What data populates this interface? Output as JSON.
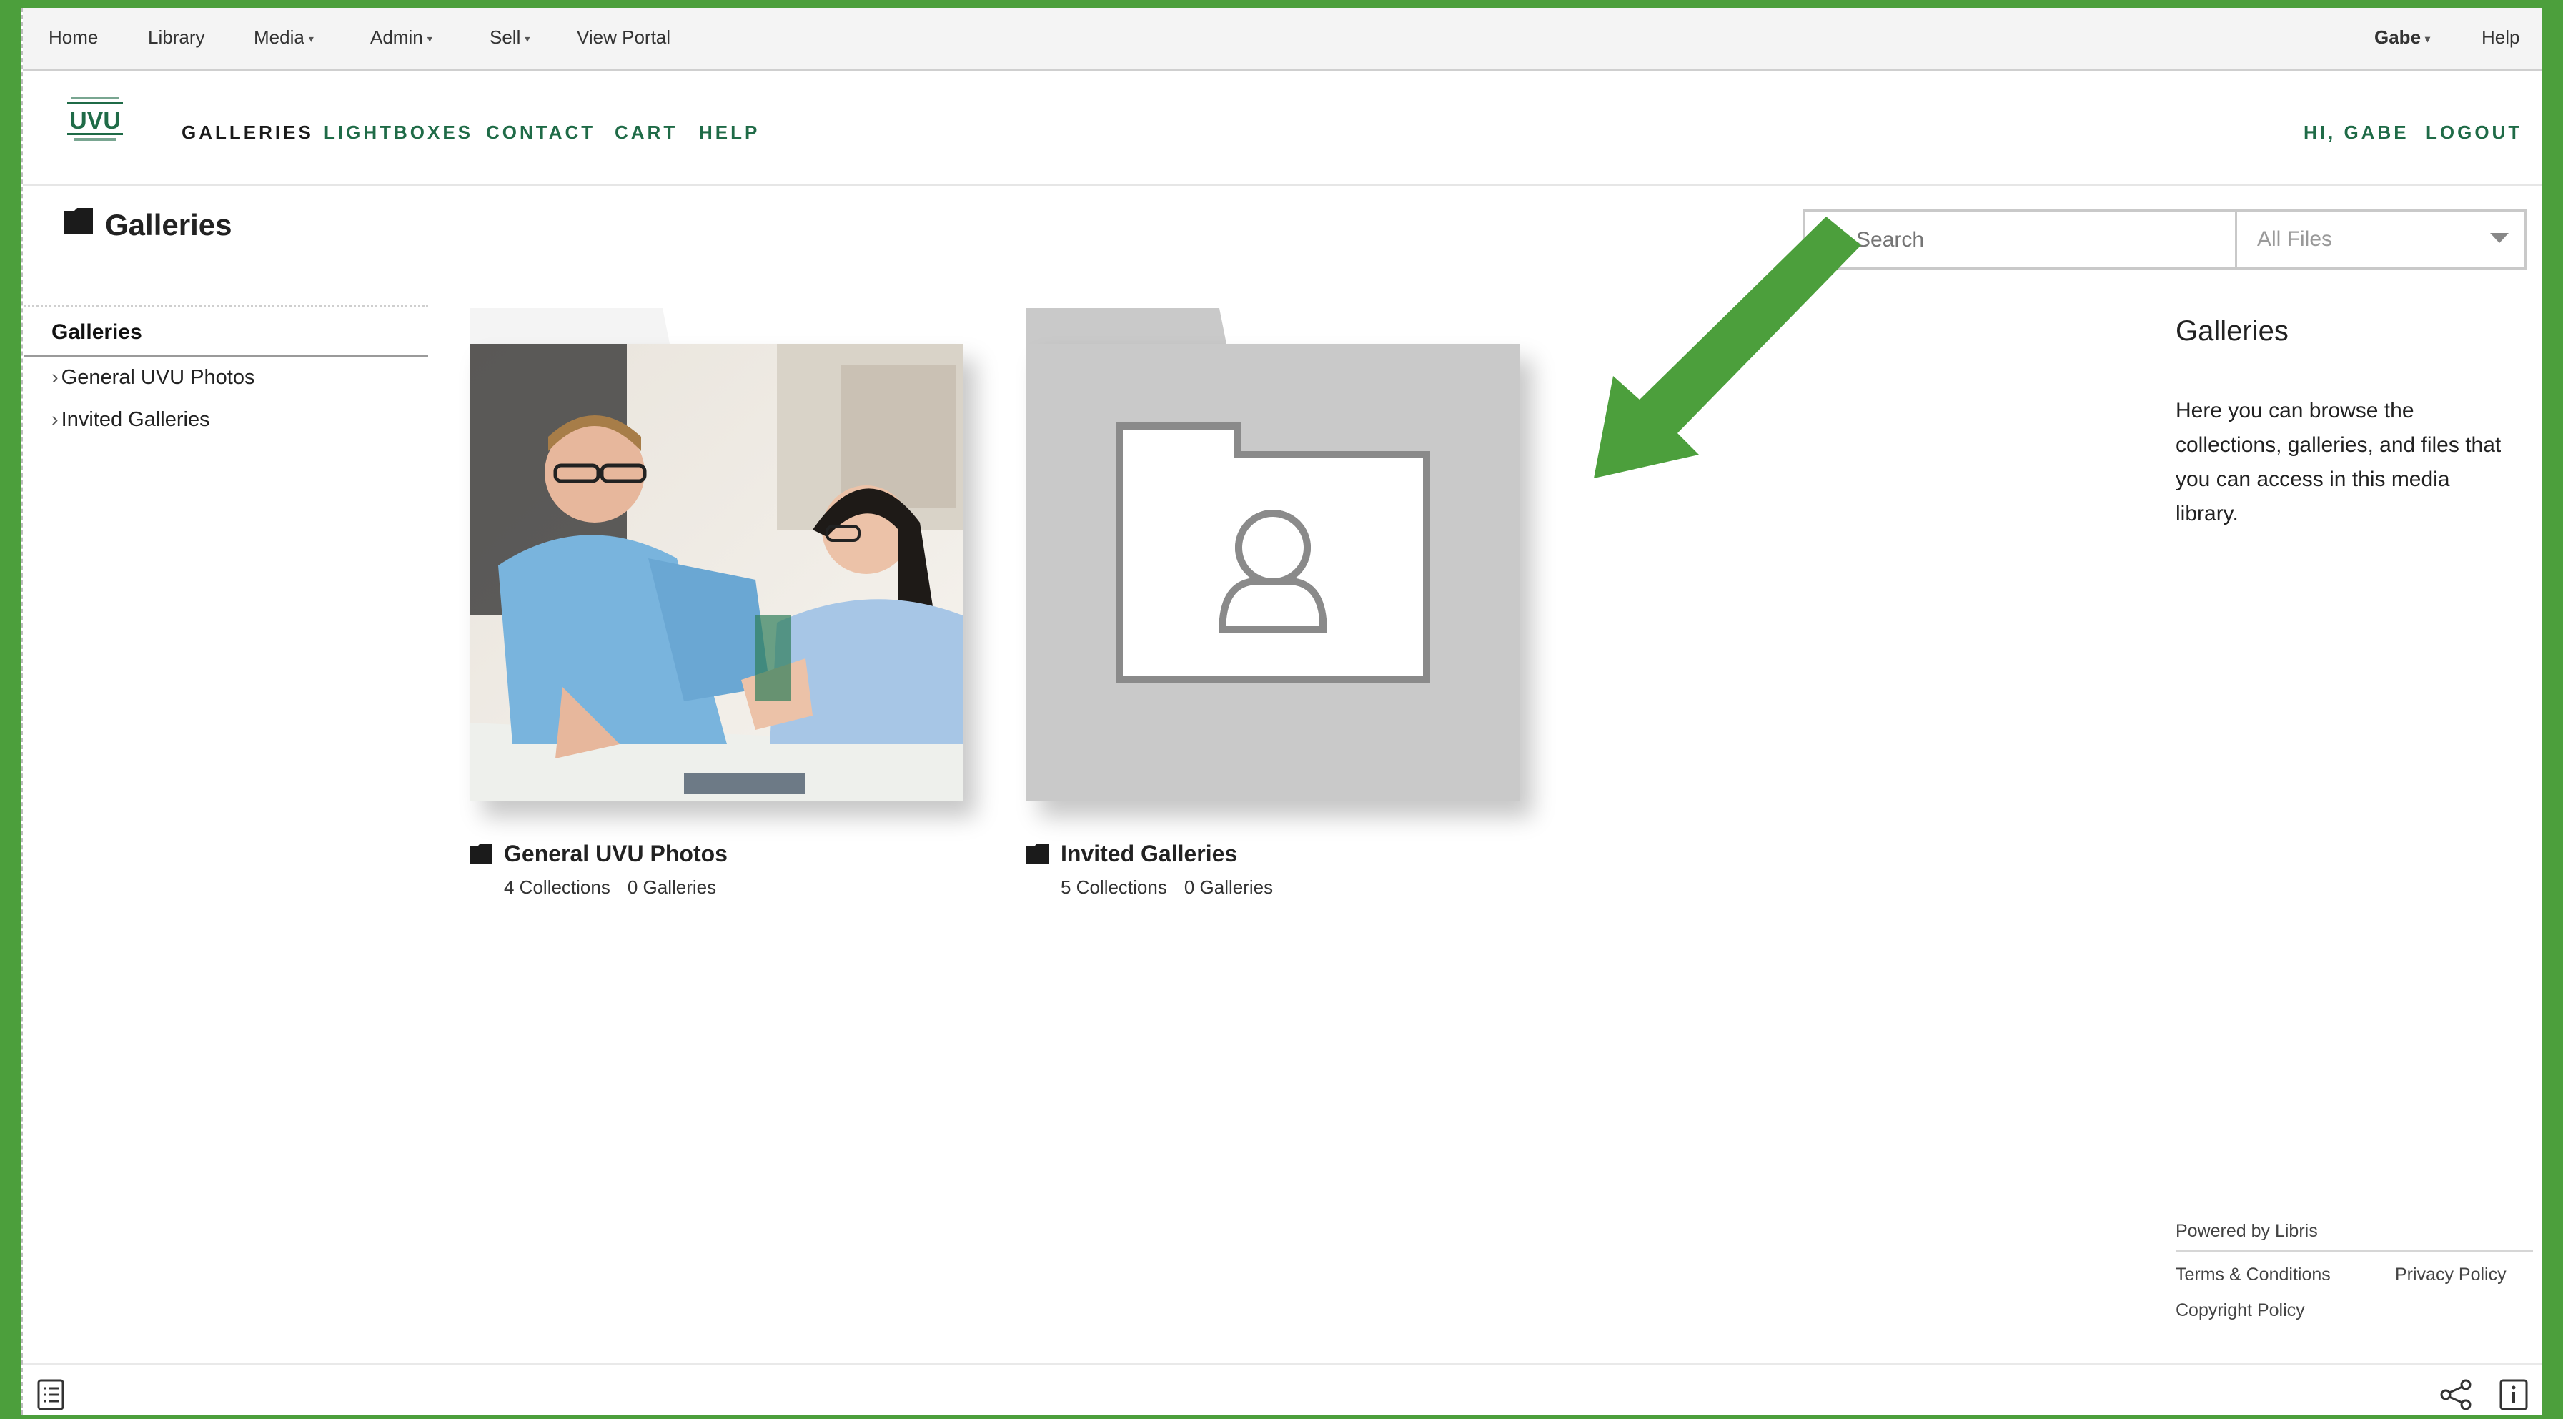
{
  "admin_bar": {
    "items": [
      {
        "label": "Home"
      },
      {
        "label": "Library"
      },
      {
        "label": "Media",
        "dropdown": true
      },
      {
        "label": "Admin",
        "dropdown": true
      },
      {
        "label": "Sell",
        "dropdown": true
      },
      {
        "label": "View Portal"
      }
    ],
    "user": "Gabe",
    "help": "Help"
  },
  "site_nav": {
    "logo_text": "UVU",
    "links": [
      "GALLERIES",
      "LIGHTBOXES",
      "CONTACT",
      "CART",
      "HELP"
    ],
    "greeting": "HI, GABE",
    "logout": "LOGOUT"
  },
  "page": {
    "title": "Galleries"
  },
  "search": {
    "placeholder": "Search",
    "filter_value": "All Files"
  },
  "sidebar": {
    "heading": "Galleries",
    "items": [
      {
        "label": "General UVU Photos"
      },
      {
        "label": "Invited Galleries"
      }
    ]
  },
  "cards": [
    {
      "title": "General UVU Photos",
      "collections": "4 Collections",
      "galleries": "0 Galleries"
    },
    {
      "title": "Invited Galleries",
      "collections": "5 Collections",
      "galleries": "0 Galleries"
    }
  ],
  "info_panel": {
    "title": "Galleries",
    "body": "Here you can browse the collections, galleries, and files that you can access in this media library."
  },
  "footer": {
    "powered": "Powered by Libris",
    "terms": "Terms & Conditions",
    "privacy": "Privacy Policy",
    "copyright": "Copyright Policy"
  },
  "colors": {
    "brand_green": "#1f6b47",
    "annotation_green": "#4c9f3c",
    "placeholder_gray": "#c9c9c9"
  },
  "icons": [
    "folder-icon",
    "search-icon",
    "chevron-down-icon",
    "user-icon",
    "list-icon",
    "share-icon",
    "info-icon",
    "annotation-arrow-icon"
  ]
}
